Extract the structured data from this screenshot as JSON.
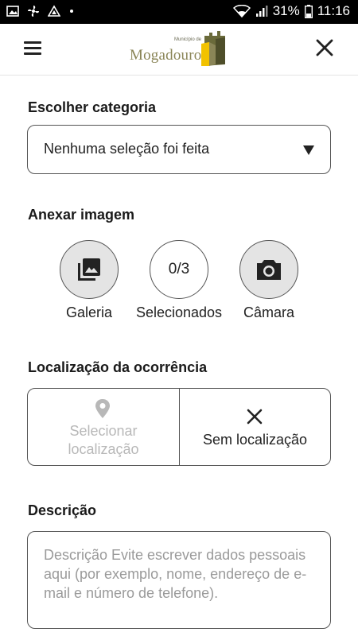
{
  "status_bar": {
    "battery": "31%",
    "time": "11:16"
  },
  "header": {
    "logo_small_text": "Município de",
    "logo_text": "Mogadouro"
  },
  "category": {
    "title": "Escolher categoria",
    "selected_value": "Nenhuma seleção foi feita"
  },
  "attach": {
    "title": "Anexar imagem",
    "gallery_label": "Galeria",
    "selected_count": "0/3",
    "selected_label": "Selecionados",
    "camera_label": "Câmara"
  },
  "location": {
    "title": "Localização da ocorrência",
    "select_label_line1": "Selecionar",
    "select_label_line2": "localização",
    "none_label": "Sem localização"
  },
  "description": {
    "title": "Descrição",
    "placeholder": "Descrição Evite escrever dados pessoais aqui (por exemplo, nome, endereço de e-mail e número de telefone)."
  },
  "colors": {
    "circle_gray": "#e4e4e4",
    "disabled_text": "#b8b8b8",
    "logo_olive": "#8a8557",
    "logo_yellow": "#f2c200"
  }
}
